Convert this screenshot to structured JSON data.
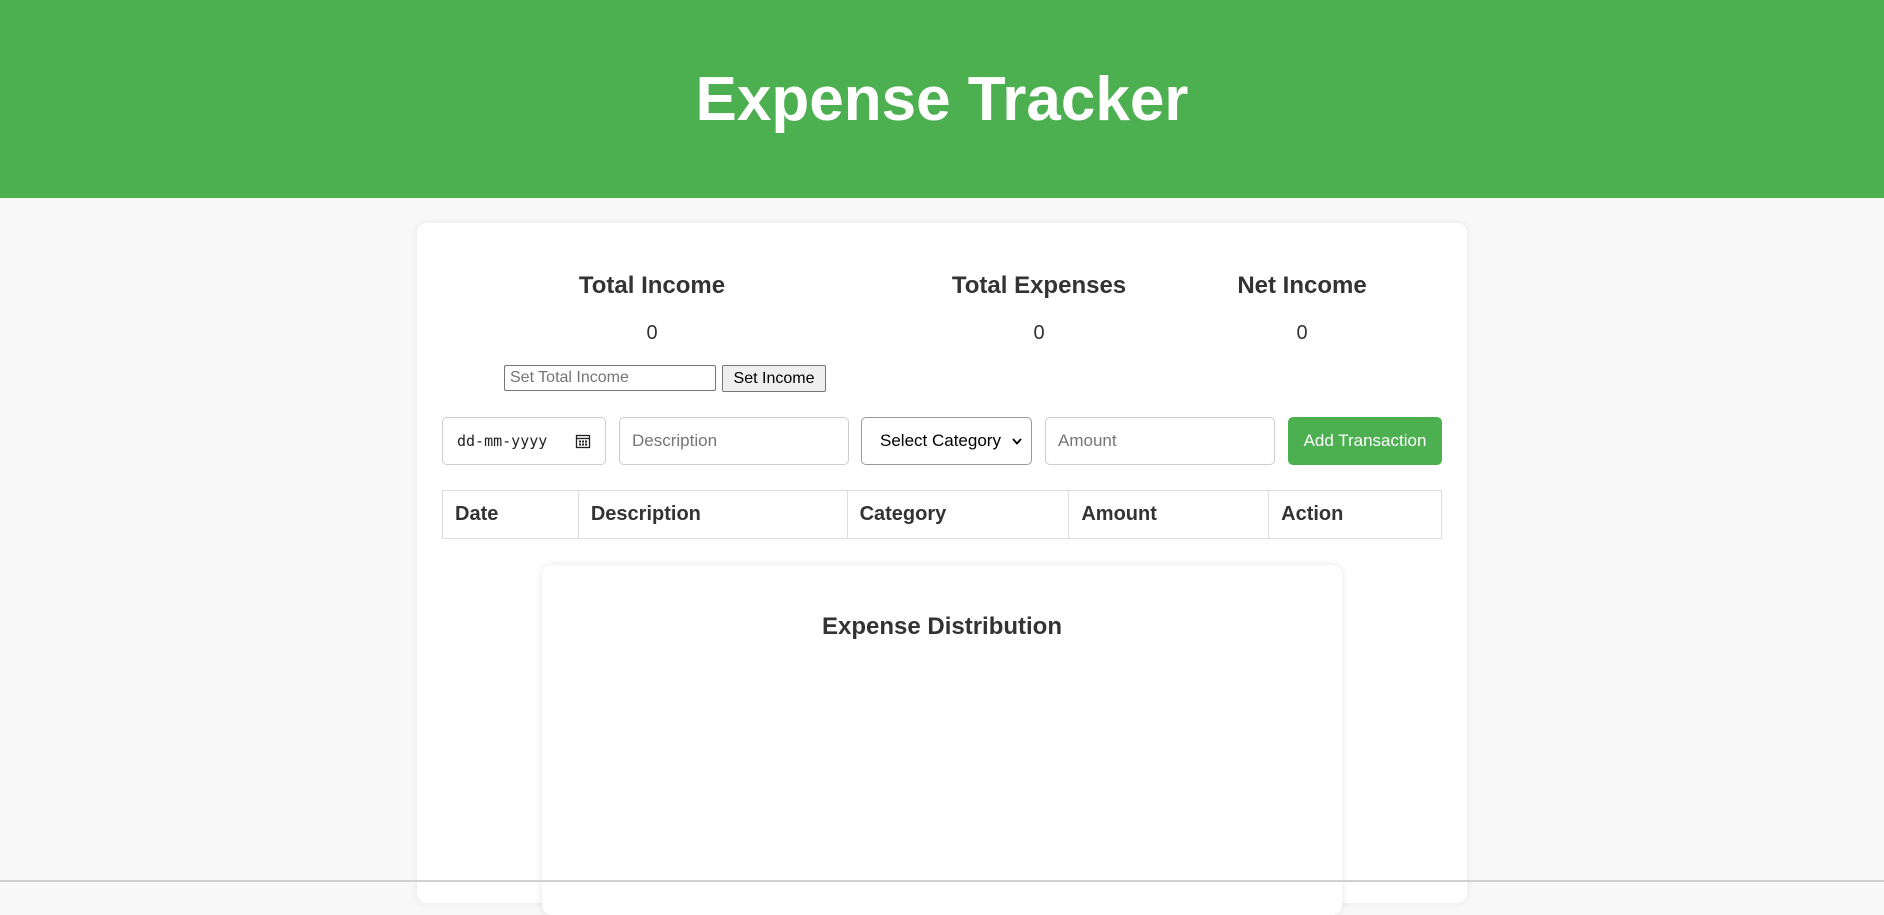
{
  "header": {
    "title": "Expense Tracker"
  },
  "summary": {
    "total_income_label": "Total Income",
    "total_income_value": "0",
    "total_expenses_label": "Total Expenses",
    "total_expenses_value": "0",
    "net_income_label": "Net Income",
    "net_income_value": "0"
  },
  "income_form": {
    "placeholder": "Set Total Income",
    "button_label": "Set Income"
  },
  "transaction_form": {
    "date_placeholder": "dd-mm-yyyy",
    "description_placeholder": "Description",
    "category_selected": "Select Category",
    "amount_placeholder": "Amount",
    "add_button_label": "Add Transaction"
  },
  "table": {
    "headers": [
      "Date",
      "Description",
      "Category",
      "Amount",
      "Action"
    ],
    "rows": []
  },
  "chart": {
    "title": "Expense Distribution"
  },
  "colors": {
    "accent": "#4caf50",
    "background": "#f8f8f8"
  }
}
